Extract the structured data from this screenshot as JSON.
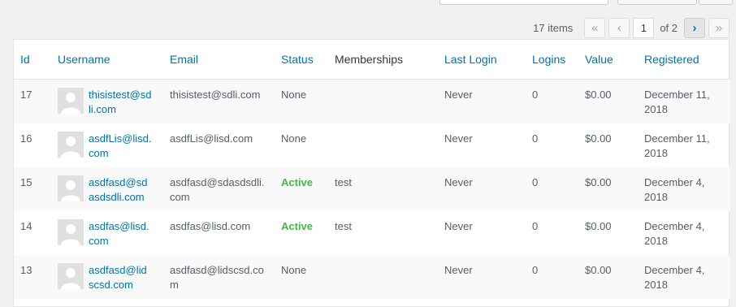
{
  "pagination": {
    "items_count": "17 items",
    "first": "«",
    "prev": "‹",
    "current_page": "1",
    "of_label": "of 2",
    "next": "›",
    "last": "»"
  },
  "table": {
    "headers": {
      "id": "Id",
      "username": "Username",
      "email": "Email",
      "status": "Status",
      "memberships": "Memberships",
      "last_login": "Last Login",
      "logins": "Logins",
      "value": "Value",
      "registered": "Registered"
    },
    "rows": [
      {
        "id": "17",
        "username": "thisistest@sdli.com",
        "email": "thisistest@sdli.com",
        "status": "None",
        "membership": "",
        "last_login": "Never",
        "logins": "0",
        "value": "$0.00",
        "registered": "December 11, 2018"
      },
      {
        "id": "16",
        "username": "asdfLis@lisd.com",
        "email": "asdfLis@lisd.com",
        "status": "None",
        "membership": "",
        "last_login": "Never",
        "logins": "0",
        "value": "$0.00",
        "registered": "December 11, 2018"
      },
      {
        "id": "15",
        "username": "asdfasd@sdasdsdli.com",
        "email": "asdfasd@sdasdsdli.com",
        "status": "Active",
        "membership": "test",
        "last_login": "Never",
        "logins": "0",
        "value": "$0.00",
        "registered": "December 4, 2018"
      },
      {
        "id": "14",
        "username": "asdfas@lisd.com",
        "email": "asdfas@lisd.com",
        "status": "Active",
        "membership": "test",
        "last_login": "Never",
        "logins": "0",
        "value": "$0.00",
        "registered": "December 4, 2018"
      },
      {
        "id": "13",
        "username": "asdfasd@lidscsd.com",
        "email": "asdfasd@lidscsd.com",
        "status": "None",
        "membership": "",
        "last_login": "Never",
        "logins": "0",
        "value": "$0.00",
        "registered": "December 4, 2018"
      }
    ]
  },
  "colors": {
    "link": "#0073aa",
    "active_status": "#46b450"
  }
}
